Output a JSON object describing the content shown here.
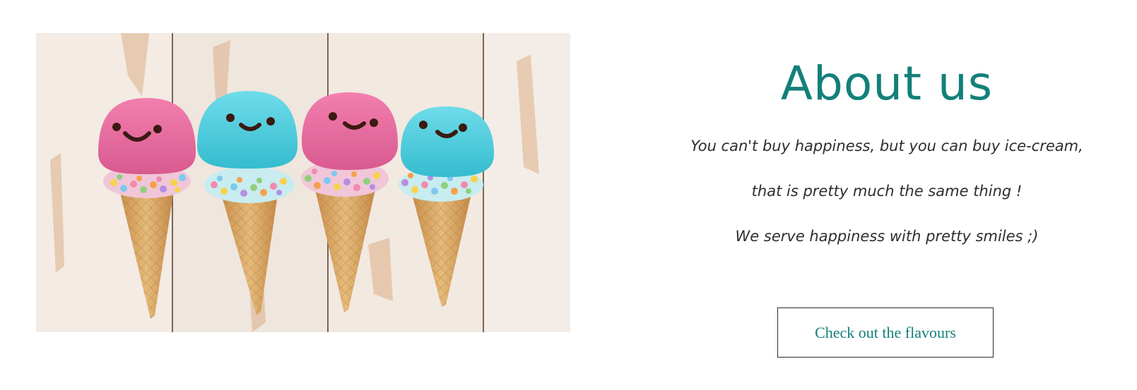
{
  "about": {
    "title": "About us",
    "lines": [
      "You can't buy happiness, but you can buy ice-cream,",
      "that is pretty much the same thing !",
      "We serve happiness with pretty smiles ;)"
    ],
    "cta_label": "Check out the flavours"
  },
  "colors": {
    "accent": "#13807a",
    "text": "#2e2e2e",
    "pink_scoop": "#ec6fa3",
    "blue_scoop": "#4dcfdf",
    "cone": "#dcae6a"
  }
}
